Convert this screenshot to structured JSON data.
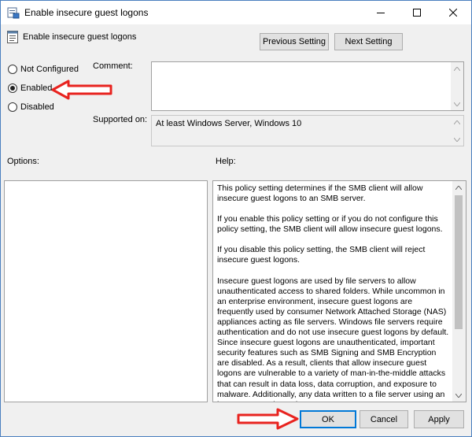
{
  "window": {
    "title": "Enable insecure guest logons",
    "controls": {
      "minimize": "minimize",
      "maximize": "maximize",
      "close": "close"
    }
  },
  "header": {
    "policy_name": "Enable insecure guest logons",
    "previous_label": "Previous Setting",
    "next_label": "Next Setting"
  },
  "state": {
    "options": [
      {
        "label": "Not Configured",
        "checked": false
      },
      {
        "label": "Enabled",
        "checked": true
      },
      {
        "label": "Disabled",
        "checked": false
      }
    ]
  },
  "comment": {
    "label": "Comment:",
    "value": ""
  },
  "supported": {
    "label": "Supported on:",
    "value": "At least Windows Server, Windows 10"
  },
  "options_panel": {
    "label": "Options:"
  },
  "help_panel": {
    "label": "Help:",
    "paragraphs": [
      "This policy setting determines if the SMB client will allow insecure guest logons to an SMB server.",
      "If you enable this policy setting or if you do not configure this policy setting, the SMB client will allow insecure guest logons.",
      "If you disable this policy setting, the SMB client will reject insecure guest logons.",
      "Insecure guest logons are used by file servers to allow unauthenticated access to shared folders. While uncommon in an enterprise environment, insecure guest logons are frequently used by consumer Network Attached Storage (NAS) appliances acting as file servers. Windows file servers require authentication and do not use insecure guest logons by default. Since insecure guest logons are unauthenticated, important security features such as SMB Signing and SMB Encryption are disabled. As a result, clients that allow insecure guest logons are vulnerable to a variety of man-in-the-middle attacks that can result in data loss, data corruption, and exposure to malware. Additionally, any data written to a file server using an insecure guest logon is"
    ]
  },
  "footer": {
    "ok_label": "OK",
    "cancel_label": "Cancel",
    "apply_label": "Apply"
  },
  "colors": {
    "annotation_arrow": "#e8231f",
    "focus_border": "#0078d7"
  },
  "icons": {
    "app": "policy-editor-icon",
    "policy": "policy-setting-icon"
  }
}
